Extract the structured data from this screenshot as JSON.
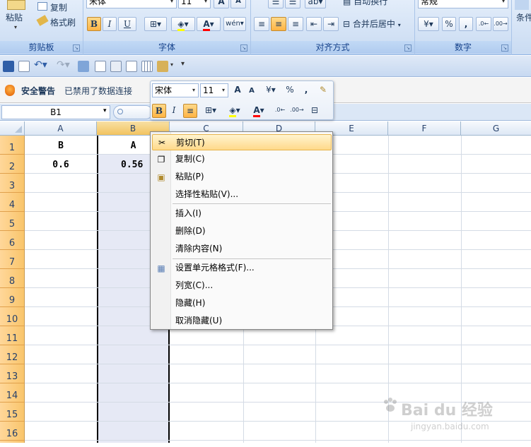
{
  "ribbon": {
    "clipboard": {
      "paste": "粘贴",
      "copy": "复制",
      "format_painter": "格式刷",
      "title": "剪贴板"
    },
    "font": {
      "font_name": "宋体",
      "font_size": "11",
      "bold": "B",
      "italic": "I",
      "underline": "U",
      "title": "字体"
    },
    "alignment": {
      "wrap_text": "自动换行",
      "merge_center": "合并后居中",
      "title": "对齐方式"
    },
    "number": {
      "format": "常规",
      "percent": "%",
      "comma": ",",
      "title": "数字"
    },
    "styles": {
      "conditional": "条件"
    }
  },
  "security": {
    "warning": "安全警告",
    "message": "已禁用了数据连接"
  },
  "formula_bar": {
    "name_box": "B1"
  },
  "mini_toolbar": {
    "font_name": "宋体",
    "font_size": "11",
    "percent": "%",
    "comma": ",",
    "bold": "B",
    "italic": "I"
  },
  "grid": {
    "columns": [
      "A",
      "B",
      "C",
      "D",
      "E",
      "F",
      "G"
    ],
    "rows": [
      "1",
      "2",
      "3",
      "4",
      "5",
      "6",
      "7",
      "8",
      "9",
      "10",
      "11",
      "12",
      "13",
      "14",
      "15",
      "16"
    ],
    "cells": {
      "A1": "B",
      "B1": "A",
      "A2": "0.6",
      "B2": "0.56"
    }
  },
  "context_menu": {
    "items": [
      {
        "label": "剪切(T)"
      },
      {
        "label": "复制(C)"
      },
      {
        "label": "粘贴(P)"
      },
      {
        "label": "选择性粘贴(V)..."
      },
      {
        "label": "插入(I)"
      },
      {
        "label": "删除(D)"
      },
      {
        "label": "清除内容(N)"
      },
      {
        "label": "设置单元格格式(F)..."
      },
      {
        "label": "列宽(C)..."
      },
      {
        "label": "隐藏(H)"
      },
      {
        "label": "取消隐藏(U)"
      }
    ]
  },
  "watermark": {
    "brand": "Bai du 经验",
    "url": "jingyan.baidu.com"
  },
  "colors": {
    "accent": "#15428b",
    "highlight": "#ffd98a",
    "row_header": "#f9c56b"
  }
}
